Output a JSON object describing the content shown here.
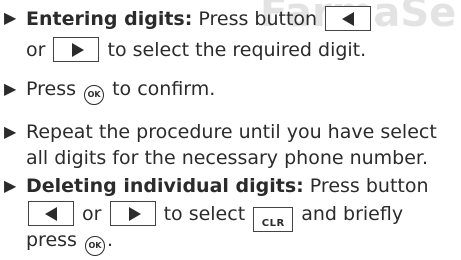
{
  "watermark": "FarmaSe",
  "steps": [
    {
      "bold": "Entering digits:",
      "line1_a": "Press button",
      "line2_a": "or",
      "line2_b": "to select the required digit."
    },
    {
      "line1_a": "Press",
      "line1_b": "to confirm."
    },
    {
      "line1": "Repeat the procedure until you have select",
      "line2": "all digits for the necessary phone number."
    },
    {
      "bold": "Deleting individual digits:",
      "line1_a": "Press button",
      "line2_a": "or",
      "line2_b": "to select",
      "line2_c": "and briefly",
      "line3_a": "press",
      "line3_b": "."
    }
  ],
  "keys": {
    "ok_label": "OK",
    "clr_label": "CLR",
    "left_icon": "left-arrow-icon",
    "right_icon": "right-arrow-icon"
  }
}
